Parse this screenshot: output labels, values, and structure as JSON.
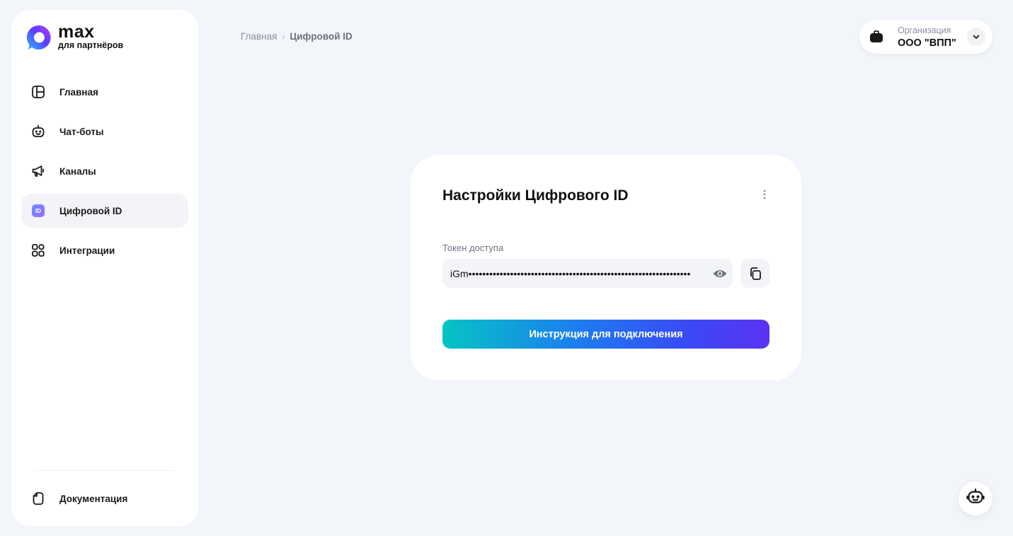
{
  "brand": {
    "title": "max",
    "subtitle": "для партнёров",
    "gradient": [
      "#2fb8ff",
      "#5b3cff",
      "#c23cff"
    ]
  },
  "sidebar": {
    "items": [
      {
        "label": "Главная",
        "icon": "dashboard-icon",
        "active": false
      },
      {
        "label": "Чат-боты",
        "icon": "robot-icon",
        "active": false
      },
      {
        "label": "Каналы",
        "icon": "megaphone-icon",
        "active": false
      },
      {
        "label": "Цифровой ID",
        "icon": "id-badge-icon",
        "icon_text": "ID",
        "active": true
      },
      {
        "label": "Интеграции",
        "icon": "grid-icon",
        "active": false
      }
    ],
    "footer_item": {
      "label": "Документация",
      "icon": "document-icon"
    }
  },
  "breadcrumb": {
    "home": "Главная",
    "separator": "›",
    "current": "Цифровой ID"
  },
  "organization": {
    "caption": "Организация",
    "name": "ООО \"ВПП\"",
    "icon": "briefcase-icon"
  },
  "card": {
    "title": "Настройки Цифрового ID",
    "token_label": "Токен доступа",
    "token_value": "iGm••••••••••••••••••••••••••••••••••••••••••••••••••••••••••••••••",
    "cta_label": "Инструкция для подключения"
  },
  "colors": {
    "background": "#f2f5fa",
    "cta_gradient": [
      "#05c4c4",
      "#1d7cf0",
      "#3a49f5",
      "#5a33f2"
    ]
  }
}
